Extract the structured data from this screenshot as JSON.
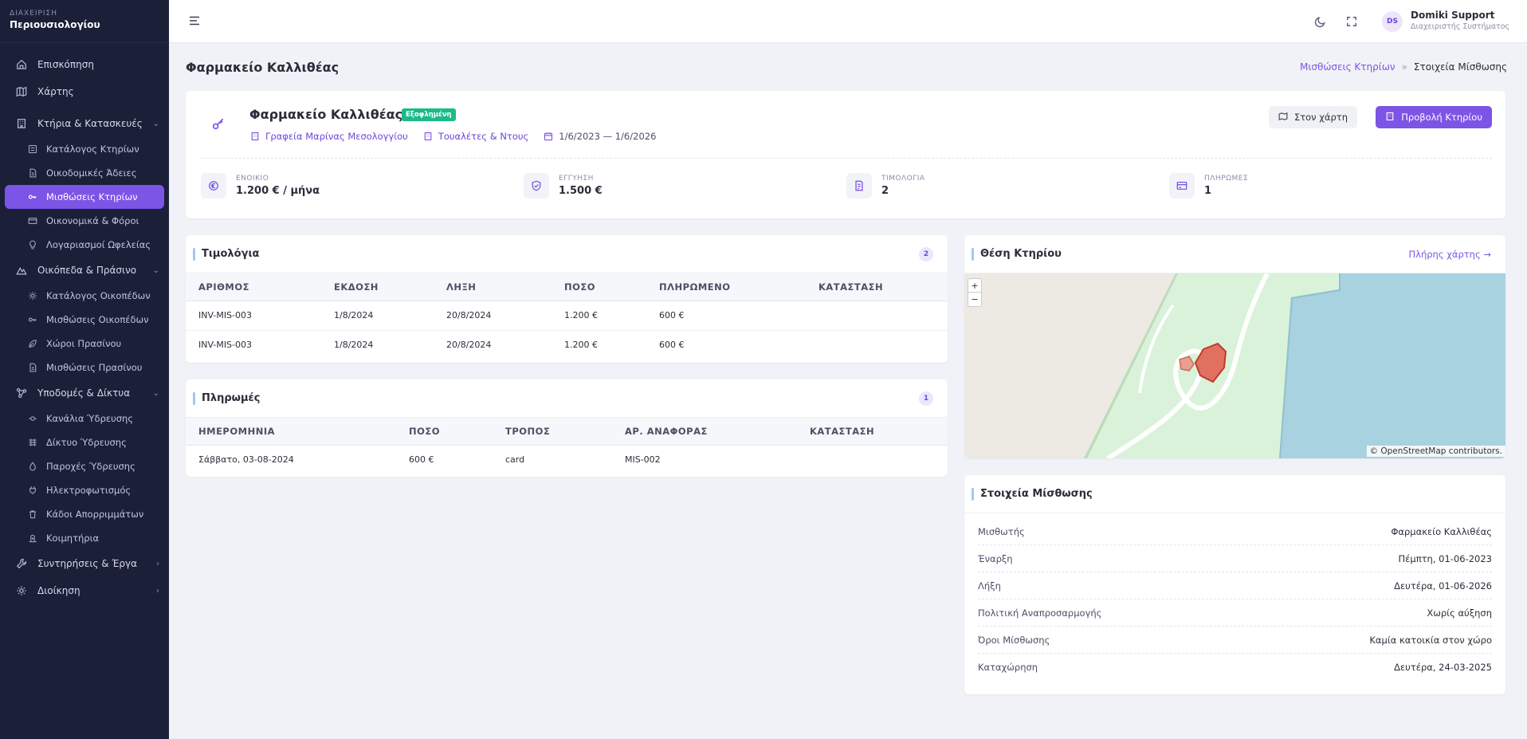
{
  "brand": {
    "sub": "ΔΙΑΧΕΙΡΙΣΗ",
    "title": "Περιουσιολογίου"
  },
  "sidebar": {
    "top": [
      {
        "label": "Επισκόπηση",
        "icon": "home-icon"
      },
      {
        "label": "Χάρτης",
        "icon": "map-icon"
      }
    ],
    "groups": [
      {
        "label": "Κτήρια & Κατασκευές",
        "icon": "building-icon",
        "expanded": true,
        "items": [
          {
            "label": "Κατάλογος Κτηρίων",
            "icon": "list-icon",
            "active": false
          },
          {
            "label": "Οικοδομικές Άδειες",
            "icon": "document-icon",
            "active": false
          },
          {
            "label": "Μισθώσεις Κτηρίων",
            "icon": "key-icon",
            "active": true
          },
          {
            "label": "Οικονομικά & Φόροι",
            "icon": "wallet-icon",
            "active": false
          },
          {
            "label": "Λογαριασμοί Ωφελείας",
            "icon": "bulb-icon",
            "active": false
          }
        ]
      },
      {
        "label": "Οικόπεδα & Πράσινο",
        "icon": "land-icon",
        "expanded": true,
        "items": [
          {
            "label": "Κατάλογος Οικοπέδων",
            "icon": "gear-icon",
            "active": false
          },
          {
            "label": "Μισθώσεις Οικοπέδων",
            "icon": "key-icon",
            "active": false
          },
          {
            "label": "Χώροι Πρασίνου",
            "icon": "leaf-icon",
            "active": false
          },
          {
            "label": "Μισθώσεις Πρασίνου",
            "icon": "document-icon",
            "active": false
          }
        ]
      },
      {
        "label": "Υποδομές & Δίκτυα",
        "icon": "network-icon",
        "expanded": true,
        "items": [
          {
            "label": "Κανάλια Ύδρευσης",
            "icon": "channel-icon",
            "active": false
          },
          {
            "label": "Δίκτυο Ύδρευσης",
            "icon": "grid-icon",
            "active": false
          },
          {
            "label": "Παροχές Ύδρευσης",
            "icon": "drop-icon",
            "active": false
          },
          {
            "label": "Ηλεκτροφωτισμός",
            "icon": "plug-icon",
            "active": false
          },
          {
            "label": "Κάδοι Απορριμμάτων",
            "icon": "bin-icon",
            "active": false
          },
          {
            "label": "Κοιμητήρια",
            "icon": "cemetery-icon",
            "active": false
          }
        ]
      }
    ],
    "bottom": [
      {
        "label": "Συντηρήσεις & Έργα",
        "icon": "wrench-icon"
      },
      {
        "label": "Διοίκηση",
        "icon": "gear-icon"
      }
    ]
  },
  "topbar": {
    "user_initials": "DS",
    "user_name": "Domiki Support",
    "user_role": "Διαχειριστής Συστήματος"
  },
  "page": {
    "title": "Φαρμακείο Καλλιθέας",
    "breadcrumb_link": "Μισθώσεις Κτηρίων",
    "breadcrumb_sep": "»",
    "breadcrumb_current": "Στοιχεία Μίσθωσης"
  },
  "summary": {
    "name": "Φαρμακείο Καλλιθέας",
    "status": "Εξοφλημένη",
    "status_color": "#1db989",
    "building": "Γραφεία Μαρίνας Μεσολογγίου",
    "space": "Τουαλέτες & Ντους",
    "period": "1/6/2023 — 1/6/2026",
    "btn_map": "Στον χάρτη",
    "btn_view": "Προβολή Κτηρίου",
    "stats": [
      {
        "label": "ΕΝΟΙΚΙΟ",
        "value": "1.200 € / μήνα",
        "icon": "euro-icon"
      },
      {
        "label": "ΕΓΓΥΗΣΗ",
        "value": "1.500 €",
        "icon": "shield-icon"
      },
      {
        "label": "ΤΙΜΟΛΟΓΙΑ",
        "value": "2",
        "icon": "invoice-icon"
      },
      {
        "label": "ΠΛΗΡΩΜΕΣ",
        "value": "1",
        "icon": "card-icon"
      }
    ]
  },
  "invoices": {
    "title": "Τιμολόγια",
    "count": "2",
    "columns": [
      "ΑΡΙΘΜΟΣ",
      "ΕΚΔΟΣΗ",
      "ΛΗΞΗ",
      "ΠΟΣΟ",
      "ΠΛΗΡΩΜΕΝΟ",
      "ΚΑΤΑΣΤΑΣΗ"
    ],
    "rows": [
      [
        "INV-MIS-003",
        "1/8/2024",
        "20/8/2024",
        "1.200 €",
        "600 €",
        ""
      ],
      [
        "INV-MIS-003",
        "1/8/2024",
        "20/8/2024",
        "1.200 €",
        "600 €",
        ""
      ]
    ]
  },
  "payments": {
    "title": "Πληρωμές",
    "count": "1",
    "columns": [
      "ΗΜΕΡΟΜΗΝΙΑ",
      "ΠΟΣΟ",
      "ΤΡΟΠΟΣ",
      "ΑΡ. ΑΝΑΦΟΡΑΣ",
      "ΚΑΤΑΣΤΑΣΗ"
    ],
    "rows": [
      [
        "Σάββατο, 03-08-2024",
        "600 €",
        "card",
        "MIS-002",
        ""
      ]
    ]
  },
  "location": {
    "title": "Θέση Κτηρίου",
    "full_map": "Πλήρης χάρτης →",
    "zoom_in": "+",
    "zoom_out": "−",
    "attribution": "© OpenStreetMap contributors."
  },
  "details": {
    "title": "Στοιχεία Μίσθωσης",
    "rows": [
      {
        "key": "Μισθωτής",
        "value": "Φαρμακείο Καλλιθέας"
      },
      {
        "key": "Έναρξη",
        "value": "Πέμπτη, 01-06-2023"
      },
      {
        "key": "Λήξη",
        "value": "Δευτέρα, 01-06-2026"
      },
      {
        "key": "Πολιτική Αναπροσαρμογής",
        "value": "Χωρίς αύξηση"
      },
      {
        "key": "Όροι Μίσθωσης",
        "value": "Καμία κατοικία στον χώρο"
      },
      {
        "key": "Καταχώρηση",
        "value": "Δευτέρα, 24-03-2025"
      }
    ]
  }
}
